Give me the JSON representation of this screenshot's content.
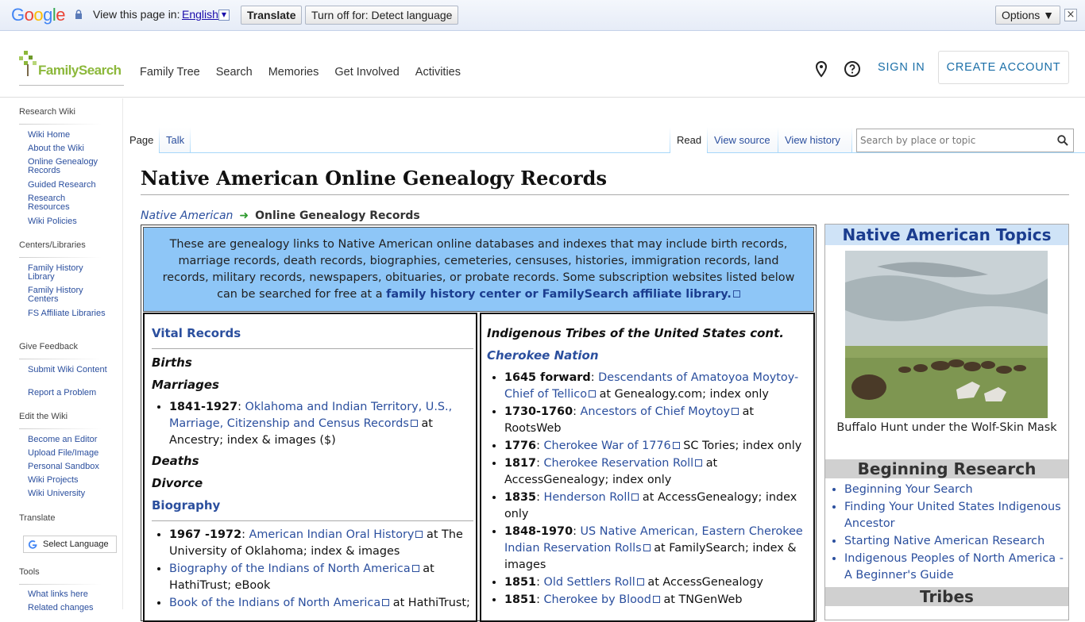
{
  "translate_bar": {
    "view_label": "View this page in:",
    "language": "English",
    "translate_button": "Translate",
    "turnoff_button": "Turn off for: Detect language",
    "options_button": "Options ▼"
  },
  "header": {
    "logo_text": "FamilySearch",
    "nav": [
      "Family Tree",
      "Search",
      "Memories",
      "Get Involved",
      "Activities"
    ],
    "sign_in": "SIGN IN",
    "create_account": "CREATE ACCOUNT"
  },
  "sidebar": {
    "research_wiki": "Research Wiki",
    "wiki_items": [
      "Wiki Home",
      "About the Wiki",
      "Online Genealogy Records",
      "Guided Research",
      "Research Resources",
      "Wiki Policies"
    ],
    "centers": "Centers/Libraries",
    "center_items": [
      "Family History Library",
      "Family History Centers",
      "FS Affiliate Libraries"
    ],
    "feedback": "Give Feedback",
    "feedback_items": [
      "Submit Wiki Content",
      "Report a Problem"
    ],
    "edit": "Edit the Wiki",
    "edit_items": [
      "Become an Editor",
      "Upload File/Image",
      "Personal Sandbox",
      "Wiki Projects",
      "Wiki University"
    ],
    "translate": "Translate",
    "select_language": "Select Language",
    "tools": "Tools",
    "tool_items": [
      "What links here",
      "Related changes"
    ]
  },
  "tabs": {
    "page": "Page",
    "talk": "Talk",
    "read": "Read",
    "view_source": "View source",
    "view_history": "View history",
    "search_placeholder": "Search by place or topic"
  },
  "article": {
    "title": "Native American Online Genealogy Records",
    "crumb_parent": "Native American",
    "crumb_current": "Online Genealogy Records",
    "intro_text": "These are genealogy links to Native American online databases and indexes that may include birth records, marriage records, death records, biographies, cemeteries, censuses, histories, immigration records, land records, military records, newspapers, obituaries, or probate records. Some subscription websites listed below can be searched for free at a ",
    "intro_link": "family history center or FamilySearch affiliate library.",
    "left": {
      "vital_records": "Vital Records",
      "births": "Births",
      "marriages": "Marriages",
      "marriage_item": {
        "year": "1841-1927",
        "link": "Oklahoma and Indian Territory, U.S., Marriage, Citizenship and Census Records",
        "rest": " at Ancestry; index & images ($)"
      },
      "deaths": "Deaths",
      "divorce": "Divorce",
      "biography": "Biography",
      "bio_items": [
        {
          "year": "1967 -1972",
          "link": "American Indian Oral History",
          "rest": " at The University of Oklahoma; index & images"
        },
        {
          "year": "",
          "link": "Biography of the Indians of North America",
          "rest": " at HathiTrust; eBook"
        },
        {
          "year": "",
          "link": "Book of the Indians of North America",
          "rest": " at HathiTrust;"
        }
      ]
    },
    "right": {
      "heading": "Indigenous Tribes of the United States cont.",
      "cherokee": "Cherokee Nation",
      "items": [
        {
          "year": "1645 forward",
          "link": "Descendants of Amatoyoa Moytoy-Chief of Tellico",
          "rest": " at Genealogy.com; index only"
        },
        {
          "year": "1730-1760",
          "link": "Ancestors of Chief Moytoy",
          "rest": " at RootsWeb"
        },
        {
          "year": "1776",
          "link": "Cherokee War of 1776",
          "rest": " SC Tories; index only"
        },
        {
          "year": "1817",
          "link": "Cherokee Reservation Roll",
          "rest": " at AccessGenealogy; index only"
        },
        {
          "year": "1835",
          "link": "Henderson Roll",
          "rest": " at AccessGenealogy; index only"
        },
        {
          "year": "1848-1970",
          "link": "US Native American, Eastern Cherokee Indian Reservation Rolls",
          "rest": " at FamilySearch; index & images"
        },
        {
          "year": "1851",
          "link": "Old Settlers Roll",
          "rest": " at AccessGenealogy"
        },
        {
          "year": "1851",
          "link": "Cherokee by Blood",
          "rest": " at TNGenWeb"
        }
      ]
    }
  },
  "infobox": {
    "topics_title": "Native American Topics",
    "image_caption": "Buffalo Hunt under the Wolf-Skin Mask",
    "beginning_title": "Beginning Research",
    "beginning_items": [
      "Beginning Your Search",
      "Finding Your United States Indigenous Ancestor",
      "Starting Native American Research",
      "Indigenous Peoples of North America - A Beginner's Guide"
    ],
    "tribes_title": "Tribes"
  }
}
